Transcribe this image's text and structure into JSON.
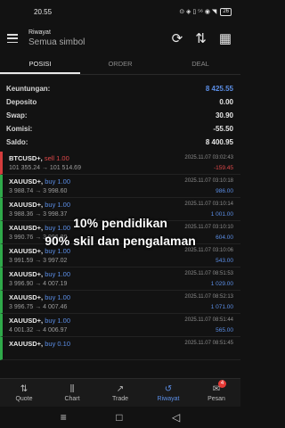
{
  "status": {
    "time": "20.55",
    "icons": "⊙ ◈ ▯ ⁵⁶ ◉ ◥",
    "battery": "26"
  },
  "header": {
    "subtitle": "Riwayat",
    "title": "Semua simbol"
  },
  "tabs": [
    {
      "label": "POSISI"
    },
    {
      "label": "ORDER"
    },
    {
      "label": "DEAL"
    }
  ],
  "summary": [
    {
      "label": "Keuntungan:",
      "value": "8 425.55"
    },
    {
      "label": "Deposito",
      "value": "0.00"
    },
    {
      "label": "Swap:",
      "value": "30.90"
    },
    {
      "label": "Komisi:",
      "value": "-55.50"
    },
    {
      "label": "Saldo:",
      "value": "8 400.95"
    }
  ],
  "positions": [
    {
      "symbol": "BTCUSD+,",
      "side": "sell 1.00",
      "date": "2025.11.07 03:02:43",
      "prices": "101 355.24 → 101 514.69",
      "pl": "-159.45"
    },
    {
      "symbol": "XAUUSD+,",
      "side": "buy 1.00",
      "date": "2025.11.07 03:10:18",
      "prices": "3 988.74 → 3 998.60",
      "pl": "986.00"
    },
    {
      "symbol": "XAUUSD+,",
      "side": "buy 1.00",
      "date": "2025.11.07 03:10:14",
      "prices": "3 988.36 → 3 998.37",
      "pl": "1 001.00"
    },
    {
      "symbol": "XAUUSD+,",
      "side": "buy 1.00",
      "date": "2025.11.07 03:10:10",
      "prices": "3 990.76 → 3 996.80",
      "pl": "604.00"
    },
    {
      "symbol": "XAUUSD+,",
      "side": "buy 1.00",
      "date": "2025.11.07 03:10:06",
      "prices": "3 991.59 → 3 997.02",
      "pl": "543.00"
    },
    {
      "symbol": "XAUUSD+,",
      "side": "buy 1.00",
      "date": "2025.11.07 08:51:53",
      "prices": "3 996.90 → 4 007.19",
      "pl": "1 029.00"
    },
    {
      "symbol": "XAUUSD+,",
      "side": "buy 1.00",
      "date": "2025.11.07 08:52:13",
      "prices": "3 996.75 → 4 007.46",
      "pl": "1 071.00"
    },
    {
      "symbol": "XAUUSD+,",
      "side": "buy 1.00",
      "date": "2025.11.07 08:51:44",
      "prices": "4 001.32 → 4 006.97",
      "pl": "565.00"
    },
    {
      "symbol": "XAUUSD+,",
      "side": "buy 0.10",
      "date": "2025.11.07 08:51:45",
      "prices": "",
      "pl": ""
    }
  ],
  "overlay": {
    "line1": "10% pendidikan",
    "line2": "90% skil dan pengalaman"
  },
  "nav": [
    {
      "label": "Quote",
      "icon": "⇅"
    },
    {
      "label": "Chart",
      "icon": "⫼"
    },
    {
      "label": "Trade",
      "icon": "↗"
    },
    {
      "label": "Riwayat",
      "icon": "↺"
    },
    {
      "label": "Pesan",
      "icon": "✉",
      "badge": "4"
    }
  ],
  "sysnav": {
    "menu": "≡",
    "home": "□",
    "back": "◁"
  }
}
